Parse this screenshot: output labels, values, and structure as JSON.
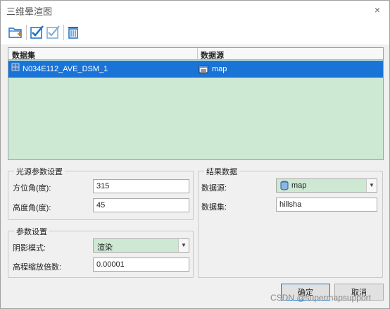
{
  "window": {
    "title": "三维晕渲图",
    "close_label": "×"
  },
  "toolbar": {
    "buttons": [
      {
        "name": "add-folder-button",
        "icon": "folder-add-icon"
      },
      {
        "name": "select-all-button",
        "icon": "check-all-icon"
      },
      {
        "name": "select-inverse-button",
        "icon": "check-icon"
      },
      {
        "name": "delete-button",
        "icon": "trash-icon"
      }
    ]
  },
  "grid": {
    "columns": [
      "数据集",
      "数据源"
    ],
    "rows": [
      {
        "dataset": "N034E112_AVE_DSM_1",
        "datasource": "map"
      }
    ]
  },
  "light": {
    "title": "光源参数设置",
    "azimuth_label": "方位角(度):",
    "azimuth": "315",
    "altitude_label": "高度角(度):",
    "altitude": "45"
  },
  "params": {
    "title": "参数设置",
    "shadow_label": "阴影模式:",
    "shadow_value": "渲染",
    "zscale_label": "高程缩放倍数:",
    "zscale": "0.00001"
  },
  "result": {
    "title": "结果数据",
    "datasource_label": "数据源:",
    "datasource_value": "map",
    "dataset_label": "数据集:",
    "dataset_value": "hillsha"
  },
  "buttons": {
    "ok": "确定",
    "cancel": "取消"
  },
  "watermark": "CSDN @supermapsupport",
  "colors": {
    "selection": "#1a73d6",
    "grid_bg": "#cde9d4",
    "combo_bg": "#cde9d4"
  }
}
